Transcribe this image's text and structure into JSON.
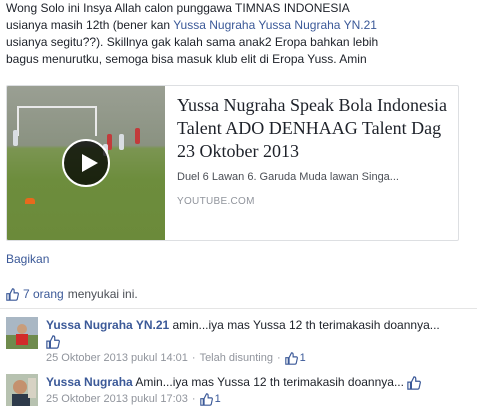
{
  "post": {
    "line1": "Wong Solo ini Insya Allah calon punggawa TIMNAS INDONESIA",
    "line2_pre": "usianya masih 12th (bener kan ",
    "line2_link1": "Yussa Nugraha",
    "line2_link2": "Yussa Nugraha YN.21",
    "line3": "usianya segitu??). Skillnya gak kalah sama anak2 Eropa bahkan lebih",
    "line4": "bagus menurutku, semoga bisa masuk klub elit di Eropa Yuss. Amin"
  },
  "share_card": {
    "title": "Yussa Nugraha Speak Bola Indonesia Talent ADO DENHAAG Talent Dag 23 Oktober 2013",
    "description": "Duel 6 Lawan 6. Garuda Muda lawan Singa...",
    "domain": "YOUTUBE.COM"
  },
  "actions": {
    "share_label": "Bagikan"
  },
  "likes": {
    "count_label": "7 orang",
    "rest_label": "menyukai ini."
  },
  "comments": [
    {
      "author": "Yussa Nugraha YN.21",
      "text": " amin...iya mas Yussa 12 th terimakasih doannya...",
      "timestamp": "25 Oktober 2013 pukul 14:01",
      "edited": "Telah disunting",
      "like_count": "1"
    },
    {
      "author": "Yussa Nugraha",
      "text": " Amin...iya mas Yussa 12 th terimakasih doannya...",
      "timestamp": "25 Oktober 2013 pukul 17:03",
      "like_count": "1"
    }
  ],
  "colors": {
    "link": "#3b5998",
    "meta": "#90949c"
  }
}
